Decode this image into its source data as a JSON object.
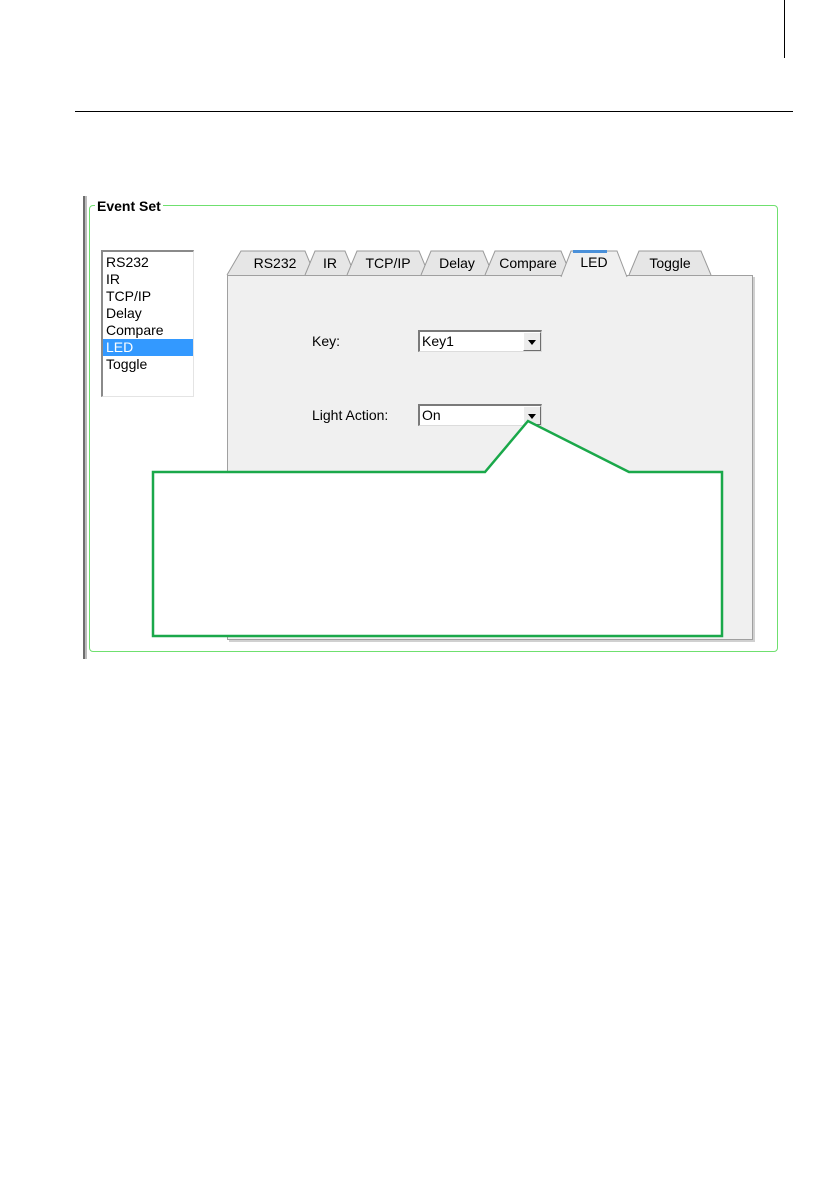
{
  "group": {
    "title": "Event Set"
  },
  "event_list": {
    "items": [
      "RS232",
      "IR",
      "TCP/IP",
      "Delay",
      "Compare",
      "LED",
      "Toggle"
    ],
    "selected": "LED"
  },
  "tabs": {
    "items": [
      "RS232",
      "IR",
      "TCP/IP",
      "Delay",
      "Compare",
      "LED",
      "Toggle"
    ],
    "active": "LED"
  },
  "led_panel": {
    "key_label": "Key:",
    "key_value": "Key1",
    "light_action_label": "Light Action:",
    "light_action_value": "On"
  },
  "callout": {
    "border_color": "#1aa84a"
  }
}
